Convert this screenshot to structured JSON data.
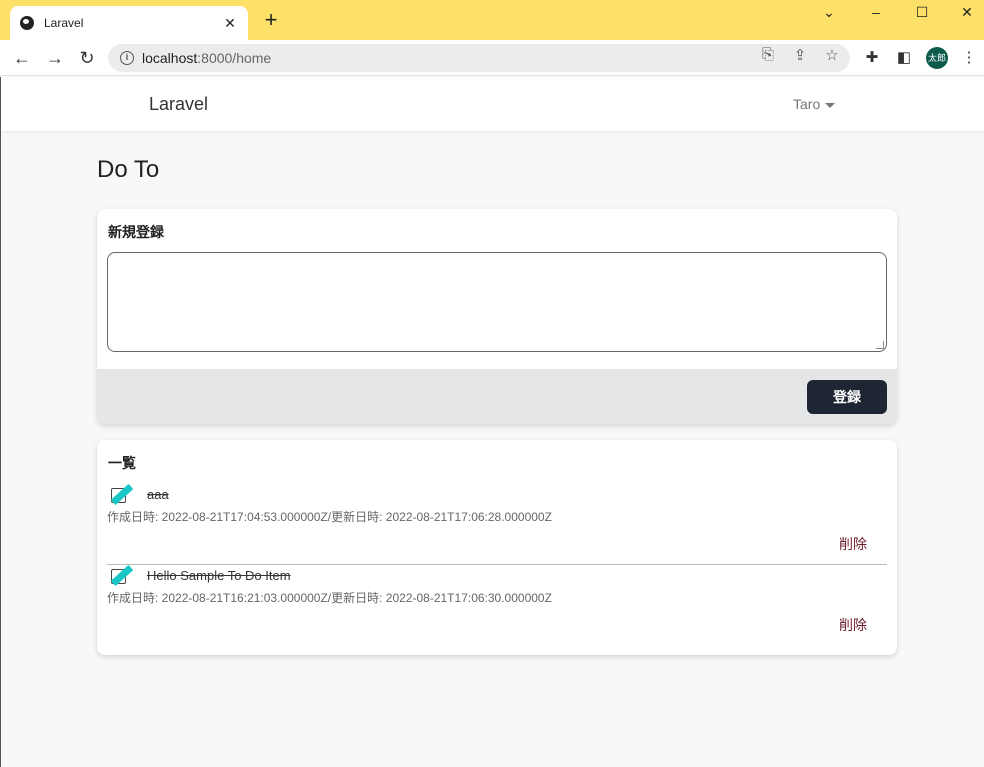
{
  "browser": {
    "tab_title": "Laravel",
    "url_host": "localhost",
    "url_path": ":8000/home",
    "avatar_text": "太郎",
    "frame_color": "#fde068"
  },
  "app": {
    "brand": "Laravel",
    "user": "Taro"
  },
  "page": {
    "heading": "Do To"
  },
  "register": {
    "title": "新規登録",
    "textarea_value": "",
    "submit_label": "登録"
  },
  "list": {
    "title": "一覧",
    "items": [
      {
        "text": "aaa",
        "meta": "作成日時: 2022-08-21T17:04:53.000000Z/更新日時: 2022-08-21T17:06:28.000000Z",
        "delete_label": "削除",
        "checked": true
      },
      {
        "text": "Hello Sample To Do Item",
        "meta": "作成日時: 2022-08-21T16:21:03.000000Z/更新日時: 2022-08-21T17:06:30.000000Z",
        "delete_label": "削除",
        "checked": true
      }
    ]
  }
}
